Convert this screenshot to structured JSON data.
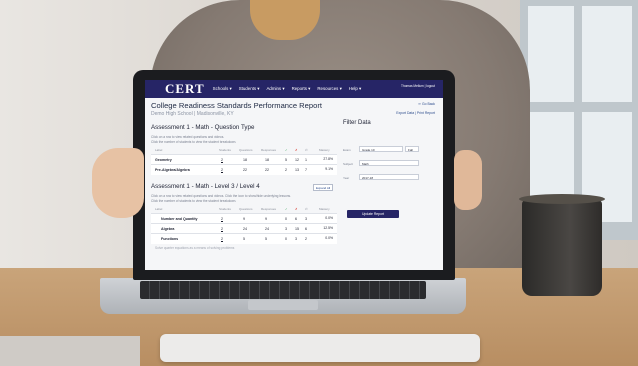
{
  "app": {
    "logo": "CERT",
    "nav": [
      "Schools ▾",
      "Students ▾",
      "Admins ▾",
      "Reports ▾",
      "Resources ▾",
      "Help ▾"
    ],
    "user": "Thomas Mellum | logout",
    "page_title": "College Readiness Standards Performance Report",
    "school": "Demo High School | Madisonville, KY",
    "go_back": "⇐ Go Back",
    "header_links": "Export Data | Print Report"
  },
  "section1": {
    "title": "Assessment 1 - Math - Question Type",
    "help1": "Click on a row to view related questions and videos.",
    "help2": "Click the number of students to view the student breakdown.",
    "columns": [
      "Label",
      "Students",
      "Questions",
      "Responses",
      "✓",
      "✗",
      "∅",
      "Mastery"
    ],
    "rows": [
      {
        "label": "Geometry",
        "students": "2",
        "questions": "18",
        "responses": "18",
        "c": "5",
        "x": "12",
        "s": "1",
        "mastery": "27.8%"
      },
      {
        "label": "Pre-Algebra/Algebra",
        "students": "2",
        "questions": "22",
        "responses": "22",
        "c": "2",
        "x": "13",
        "s": "7",
        "mastery": "9.1%"
      }
    ]
  },
  "section2": {
    "title": "Assessment 1 - Math - Level 3 / Level 4",
    "expand_label": "Expand All",
    "help1": "Click on a row to view related questions and videos. Click the icon to show/hide underlying lessons.",
    "help2": "Click the number of students to view the student breakdown.",
    "columns": [
      "Label",
      "Students",
      "Questions",
      "Responses",
      "✓",
      "✗",
      "∅",
      "Mastery"
    ],
    "rows": [
      {
        "label": "Number and Quantity",
        "students": "2",
        "questions": "9",
        "responses": "9",
        "c": "0",
        "x": "6",
        "s": "3",
        "mastery": "0.0%"
      },
      {
        "label": "Algebra",
        "students": "2",
        "questions": "24",
        "responses": "24",
        "c": "3",
        "x": "15",
        "s": "6",
        "mastery": "12.5%"
      },
      {
        "label": "Functions",
        "students": "2",
        "questions": "5",
        "responses": "5",
        "c": "0",
        "x": "3",
        "s": "2",
        "mastery": "0.0%"
      }
    ],
    "partial_row": "Solve quarter equations as a means of solving problems"
  },
  "filter": {
    "title": "Filter Data",
    "exam_label": "Exam",
    "exam_value": "Grade 10",
    "exam_term": "Fall",
    "subject_label": "Subject",
    "subject_value": "Math",
    "year_label": "Year",
    "year_value": "2017-18",
    "update_button": "Update Report"
  },
  "colors": {
    "nav_bg": "#262566",
    "correct": "#2e9e4f",
    "incorrect": "#d9362b",
    "skipped": "#6b6f7a"
  }
}
